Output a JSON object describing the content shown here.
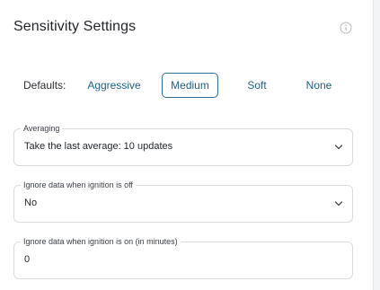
{
  "header": {
    "title": "Sensitivity Settings",
    "info_icon": "info-icon"
  },
  "defaults": {
    "label": "Defaults:",
    "options": [
      "Aggressive",
      "Medium",
      "Soft",
      "None"
    ],
    "selected": "Medium"
  },
  "fields": {
    "averaging": {
      "label": "Averaging",
      "value": "Take the last average: 10 updates",
      "icon": "chevron-down-icon"
    },
    "ignition_off": {
      "label": "Ignore data when ignition is off",
      "value": "No",
      "icon": "chevron-down-icon"
    },
    "ignition_on": {
      "label": "Ignore data when ignition is on (in minutes)",
      "value": "0"
    }
  },
  "colors": {
    "accent": "#2c6f95",
    "option_text": "#1d5f86",
    "border": "#d7dbe0"
  }
}
